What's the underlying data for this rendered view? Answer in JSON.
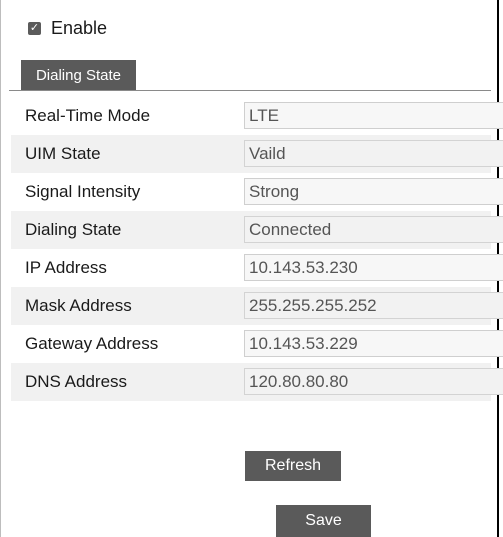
{
  "enable": {
    "label": "Enable",
    "checked": true,
    "check_glyph": "✓"
  },
  "tab": {
    "label": "Dialing State"
  },
  "fields": [
    {
      "label": "Real-Time Mode",
      "value": "LTE"
    },
    {
      "label": "UIM State",
      "value": "Vaild"
    },
    {
      "label": "Signal Intensity",
      "value": "Strong"
    },
    {
      "label": "Dialing State",
      "value": "Connected"
    },
    {
      "label": "IP Address",
      "value": "10.143.53.230"
    },
    {
      "label": "Mask Address",
      "value": "255.255.255.252"
    },
    {
      "label": "Gateway Address",
      "value": "10.143.53.229"
    },
    {
      "label": "DNS Address",
      "value": "120.80.80.80"
    }
  ],
  "buttons": {
    "refresh": "Refresh",
    "save": "Save"
  }
}
